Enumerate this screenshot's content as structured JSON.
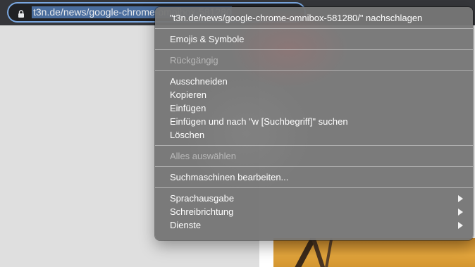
{
  "omnibox": {
    "url": "t3n.de/news/google-chrome-omnibox-581280/",
    "icon": "lock-icon"
  },
  "context_menu": {
    "lookup": "\"t3n.de/news/google-chrome-omnibox-581280/\" nachschlagen",
    "emoji": "Emojis & Symbole",
    "undo": "Rückgängig",
    "cut": "Ausschneiden",
    "copy": "Kopieren",
    "paste": "Einfügen",
    "paste_search": "Einfügen und nach \"w [Suchbegriff]\" suchen",
    "delete": "Löschen",
    "select_all": "Alles auswählen",
    "edit_engines": "Suchmaschinen bearbeiten...",
    "speech": "Sprachausgabe",
    "writing_direction": "Schreibrichtung",
    "services": "Dienste"
  },
  "colors": {
    "toolbar": "#35363a",
    "selection": "#4b6e9e",
    "menu_background": "#767676"
  }
}
